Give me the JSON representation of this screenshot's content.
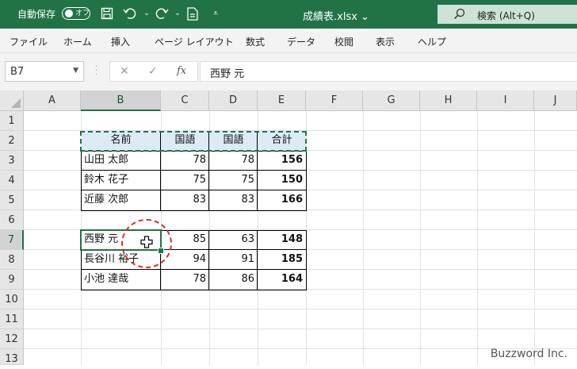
{
  "titlebar": {
    "autosave_label": "自動保存",
    "toggle_text": "オフ",
    "doc_title": "成績表.xlsx ⌄",
    "search_placeholder": "検索 (Alt+Q)",
    "accent": "#217346"
  },
  "menu": [
    "ファイル",
    "ホーム",
    "挿入",
    "ページ レイアウト",
    "数式",
    "データ",
    "校閲",
    "表示",
    "ヘルプ"
  ],
  "formula_bar": {
    "name_box": "B7",
    "fx": "fx",
    "formula": "西野 元"
  },
  "columns": [
    "A",
    "B",
    "C",
    "D",
    "E",
    "F",
    "G",
    "H",
    "I",
    "J"
  ],
  "rows": [
    "1",
    "2",
    "3",
    "4",
    "5",
    "6",
    "7",
    "8",
    "9",
    "10",
    "11",
    "12",
    "13"
  ],
  "table": {
    "header": [
      "名前",
      "国語",
      "国語",
      "合計"
    ],
    "rows": [
      [
        "山田 太郎",
        "78",
        "78",
        "156"
      ],
      [
        "鈴木 花子",
        "75",
        "75",
        "150"
      ],
      [
        "近藤 次郎",
        "83",
        "83",
        "166"
      ],
      null,
      [
        "西野 元",
        "85",
        "63",
        "148"
      ],
      [
        "長谷川 裕子",
        "94",
        "91",
        "185"
      ],
      [
        "小池 達哉",
        "78",
        "86",
        "164"
      ]
    ]
  },
  "watermark": "Buzzword Inc."
}
